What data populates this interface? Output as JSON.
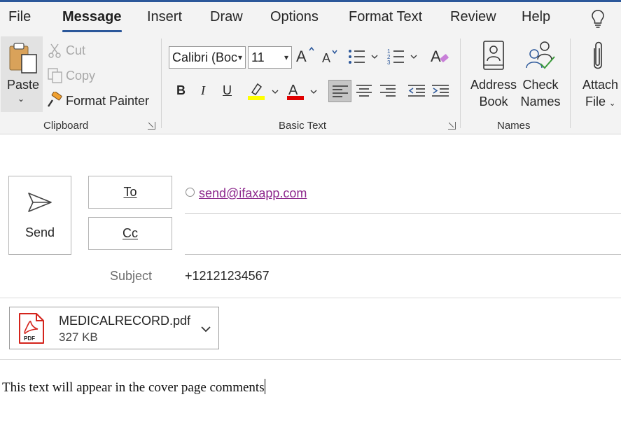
{
  "menu": {
    "tabs": [
      {
        "label": "File"
      },
      {
        "label": "Message"
      },
      {
        "label": "Insert"
      },
      {
        "label": "Draw"
      },
      {
        "label": "Options"
      },
      {
        "label": "Format Text"
      },
      {
        "label": "Review"
      },
      {
        "label": "Help"
      }
    ],
    "active_tab": "Message",
    "tell_me_icon": "lightbulb-icon"
  },
  "ribbon": {
    "clipboard": {
      "label": "Clipboard",
      "paste": "Paste",
      "cut": "Cut",
      "copy": "Copy",
      "format_painter": "Format Painter"
    },
    "basic_text": {
      "label": "Basic Text",
      "font_name": "Calibri (Boc",
      "font_size": "11",
      "bold": "B",
      "italic": "I",
      "underline": "U",
      "highlight_color": "#ffff00",
      "font_color": "#e00000"
    },
    "names": {
      "label": "Names",
      "address_book_line1": "Address",
      "address_book_line2": "Book",
      "check_names_line1": "Check",
      "check_names_line2": "Names"
    },
    "include": {
      "attach_line1": "Attach",
      "attach_line2": "File"
    }
  },
  "compose": {
    "send_label": "Send",
    "to_label": "To",
    "cc_label": "Cc",
    "to_recipient": "send@ifaxapp.com",
    "cc_value": "",
    "subject_label": "Subject",
    "subject_value": "+12121234567",
    "attachment": {
      "name": "MEDICALRECORD.pdf",
      "size": "327 KB",
      "badge": "PDF"
    },
    "body_text": "This text will appear in the cover page comments"
  },
  "colors": {
    "accent": "#2b579a",
    "link_visited": "#8e2a8e",
    "pdf_red": "#d4241c"
  }
}
